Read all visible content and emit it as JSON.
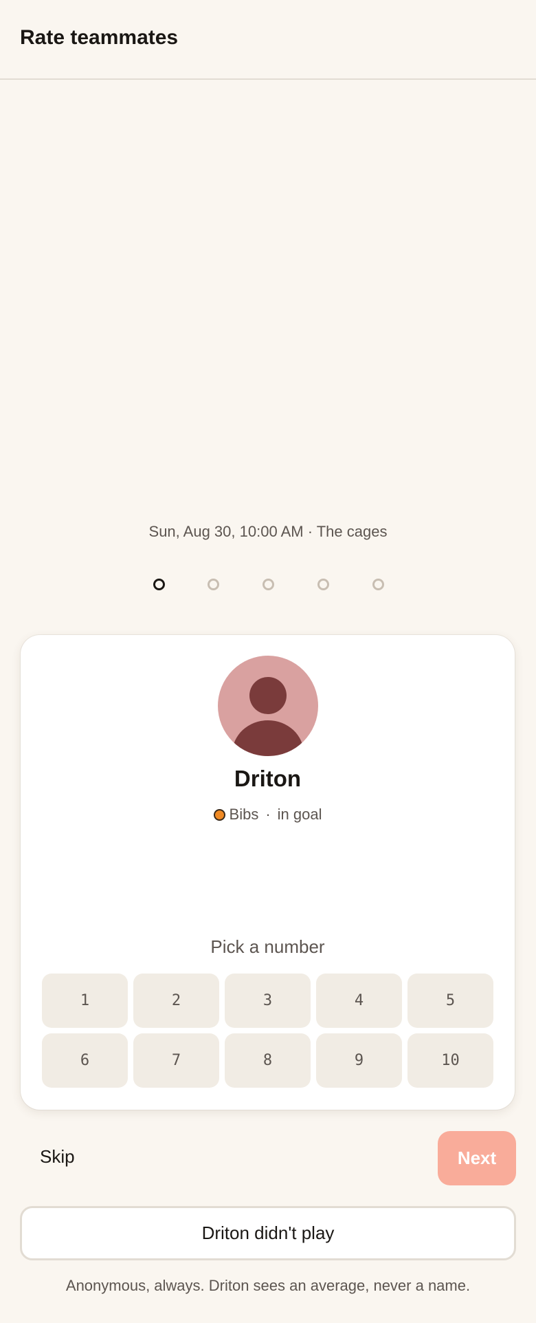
{
  "header": {
    "title": "Rate teammates"
  },
  "match": {
    "meta": "Sun, Aug 30, 10:00 AM · The cages"
  },
  "progress": {
    "total": 5,
    "current": 1
  },
  "player": {
    "name": "Driton",
    "team": "Bibs",
    "team_color": "#f08a24",
    "role": "in goal",
    "avatar_bg": "#d9a1a0",
    "avatar_fg": "#7a3b3b"
  },
  "rating": {
    "prompt": "Pick a number",
    "options": [
      "1",
      "2",
      "3",
      "4",
      "5",
      "6",
      "7",
      "8",
      "9",
      "10"
    ]
  },
  "actions": {
    "skip": "Skip",
    "next": "Next",
    "didnt_play": "Driton didn't play"
  },
  "footnote": "Anonymous, always. Driton sees an average, never a name.",
  "colors": {
    "accent": "#f9ac9a",
    "background": "#faf6f0"
  }
}
